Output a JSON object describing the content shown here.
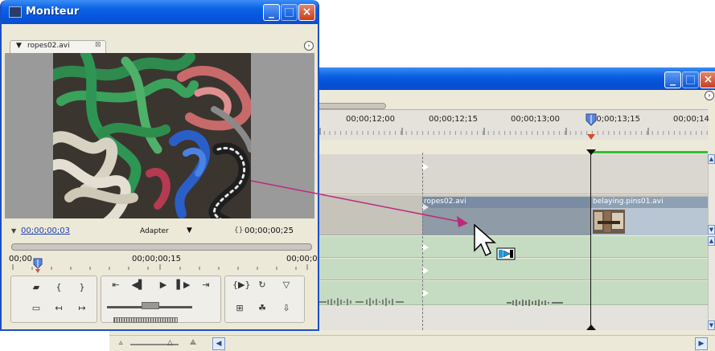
{
  "colors": {
    "xp_titlebar": "#0556e0",
    "snap_line": "#777777",
    "cti_line": "#111111",
    "drag_arrow": "#c0287e",
    "clip_header": "#7a8ca3",
    "audio_track": "#c6dcc2",
    "render_bar": "#30c030",
    "timecode_link": "#1d3fb8"
  },
  "monitor": {
    "title": "Moniteur",
    "tab_label": "ropes02.avi",
    "tab_close": "⊠",
    "tab_menu_arrow": "▼",
    "current_timecode": "00;00;00;03",
    "fit_label": "Adapter",
    "fit_arrow": "▼",
    "duration_icon": "{}",
    "duration_timecode": "00;00;00;25",
    "ruler_labels": [
      "00;00",
      "00;00;00;15",
      "00;00;0"
    ],
    "window_buttons": {
      "minimize": "_",
      "maximize": "□",
      "close": "×"
    }
  },
  "timeline": {
    "window_buttons": {
      "minimize": "_",
      "maximize": "□",
      "close": "×"
    },
    "ruler_labels": [
      "00;00;12;00",
      "00;00;12;15",
      "00;00;13;00",
      "00;00;13;15",
      "00;00;14"
    ],
    "clips": {
      "ropes": "ropes02.avi",
      "belaying": "belaying.pins01.avi"
    },
    "scroll_left": "◀",
    "scroll_right": "▶",
    "scroll_up": "▲",
    "scroll_down": "▼"
  },
  "icons": {
    "monitor_app": "monitor-app-icon",
    "drag_cursor": "insert-drag-cursor-icon",
    "panel_menu": "panel-menu-icon"
  }
}
